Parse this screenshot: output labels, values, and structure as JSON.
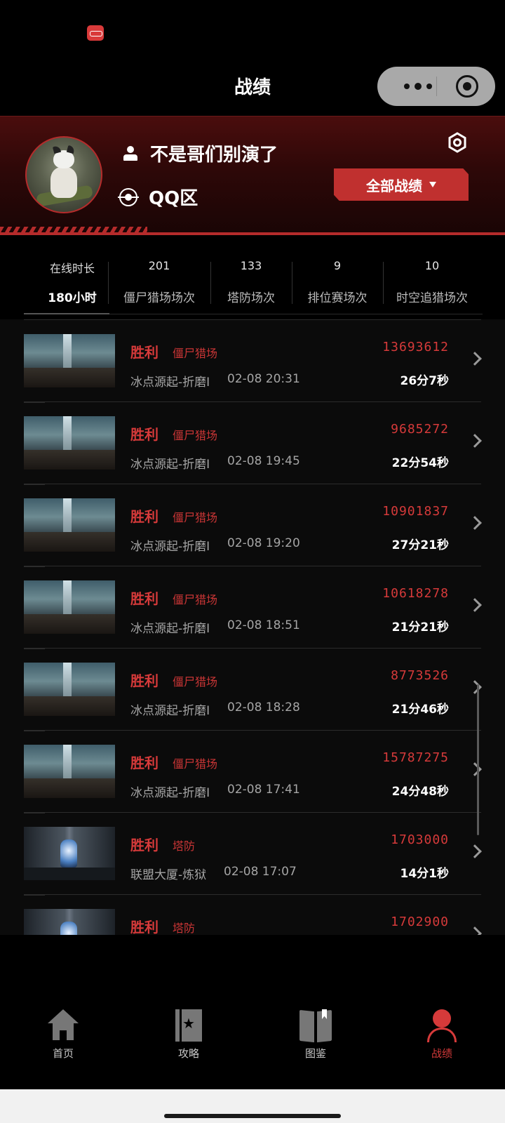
{
  "titlebar": {
    "title": "战绩"
  },
  "profile": {
    "name": "不是哥们别演了",
    "zone": "QQ区",
    "filter_label": "全部战绩"
  },
  "stats": [
    {
      "top": "在线时长",
      "bottom": "180小时"
    },
    {
      "top": "201",
      "bottom": "僵尸猎场场次"
    },
    {
      "top": "133",
      "bottom": "塔防场次"
    },
    {
      "top": "9",
      "bottom": "排位赛场次"
    },
    {
      "top": "10",
      "bottom": "时空追猎场次"
    }
  ],
  "records": [
    {
      "result": "胜利",
      "mode": "僵尸猎场",
      "map": "冰点源起-折磨I",
      "datetime": "02-08 20:31",
      "score": "13693612",
      "duration": "26分7秒",
      "thumb": "map-a"
    },
    {
      "result": "胜利",
      "mode": "僵尸猎场",
      "map": "冰点源起-折磨I",
      "datetime": "02-08 19:45",
      "score": "9685272",
      "duration": "22分54秒",
      "thumb": "map-a"
    },
    {
      "result": "胜利",
      "mode": "僵尸猎场",
      "map": "冰点源起-折磨I",
      "datetime": "02-08 19:20",
      "score": "10901837",
      "duration": "27分21秒",
      "thumb": "map-a"
    },
    {
      "result": "胜利",
      "mode": "僵尸猎场",
      "map": "冰点源起-折磨I",
      "datetime": "02-08 18:51",
      "score": "10618278",
      "duration": "21分21秒",
      "thumb": "map-a"
    },
    {
      "result": "胜利",
      "mode": "僵尸猎场",
      "map": "冰点源起-折磨I",
      "datetime": "02-08 18:28",
      "score": "8773526",
      "duration": "21分46秒",
      "thumb": "map-a"
    },
    {
      "result": "胜利",
      "mode": "僵尸猎场",
      "map": "冰点源起-折磨I",
      "datetime": "02-08 17:41",
      "score": "15787275",
      "duration": "24分48秒",
      "thumb": "map-a"
    },
    {
      "result": "胜利",
      "mode": "塔防",
      "map": "联盟大厦-炼狱",
      "datetime": "02-08 17:07",
      "score": "1703000",
      "duration": "14分1秒",
      "thumb": "map-b"
    },
    {
      "result": "胜利",
      "mode": "塔防",
      "map": "",
      "datetime": "",
      "score": "1702900",
      "duration": "",
      "thumb": "map-b"
    }
  ],
  "tabs": [
    {
      "label": "首页",
      "icon": "home-icon",
      "active": false
    },
    {
      "label": "攻略",
      "icon": "guide-icon",
      "active": false
    },
    {
      "label": "图鉴",
      "icon": "book-icon",
      "active": false
    },
    {
      "label": "战绩",
      "icon": "user-icon",
      "active": true
    }
  ],
  "colors": {
    "accent": "#d63a3a",
    "header_red": "#c0302f",
    "background": "#0b0b0b"
  }
}
